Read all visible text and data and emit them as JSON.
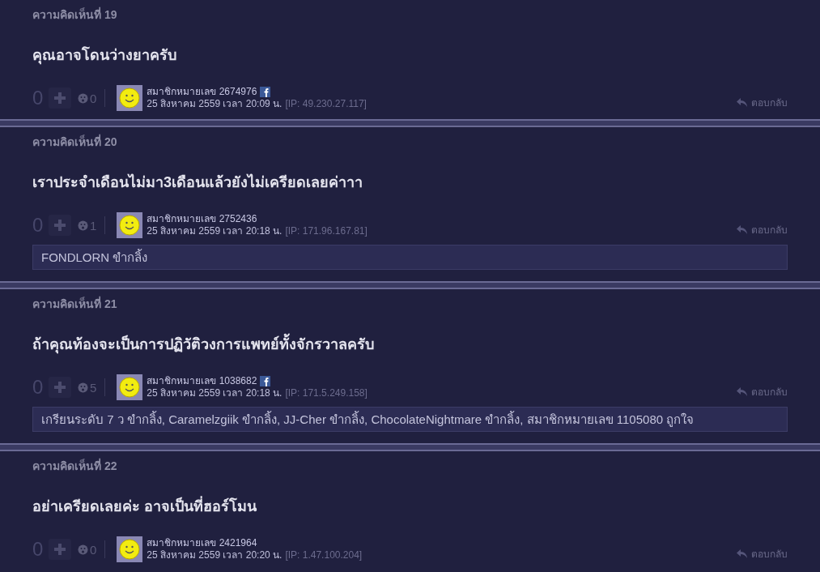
{
  "comments": [
    {
      "number": "ความคิดเห็นที่ 19",
      "text": "คุณอาจโดนว่างยาครับ",
      "votes": "0",
      "emotions": "0",
      "member": "สมาชิกหมายเลข 2674976",
      "facebook": true,
      "date": "25 สิงหาคม 2559 เวลา 20:09 น.",
      "ip": "[IP: 49.230.27.117]",
      "reply": "ตอบกลับ"
    },
    {
      "number": "ความคิดเห็นที่ 20",
      "text": "เราประจำเดือนไม่มา3เดือนแล้วยังไม่เครียดเลยค่าาา",
      "votes": "0",
      "emotions": "1",
      "member": "สมาชิกหมายเลข 2752436",
      "facebook": false,
      "date": "25 สิงหาคม 2559 เวลา 20:18 น.",
      "ip": "[IP: 171.96.167.81]",
      "reply": "ตอบกลับ",
      "reactions": "FONDLORN ขำกลิ้ง"
    },
    {
      "number": "ความคิดเห็นที่ 21",
      "text": "ถ้าคุณท้องจะเป็นการปฏิวัติวงการแพทย์ทั้งจักรวาลครับ",
      "votes": "0",
      "emotions": "5",
      "member": "สมาชิกหมายเลข 1038682",
      "facebook": true,
      "date": "25 สิงหาคม 2559 เวลา 20:18 น.",
      "ip": "[IP: 171.5.249.158]",
      "reply": "ตอบกลับ",
      "reactions": "เกรียนระดับ 7 ว ขำกลิ้ง, Caramelzgiik ขำกลิ้ง, JJ-Cher ขำกลิ้ง, ChocolateNightmare ขำกลิ้ง, สมาชิกหมายเลข 1105080 ถูกใจ"
    },
    {
      "number": "ความคิดเห็นที่ 22",
      "text": "อย่าเครียดเลยค่ะ อาจเป็นที่ฮอร์โมน",
      "votes": "0",
      "emotions": "0",
      "member": "สมาชิกหมายเลข 2421964",
      "facebook": false,
      "date": "25 สิงหาคม 2559 เวลา 20:20 น.",
      "ip": "[IP: 1.47.100.204]",
      "reply": "ตอบกลับ"
    }
  ]
}
